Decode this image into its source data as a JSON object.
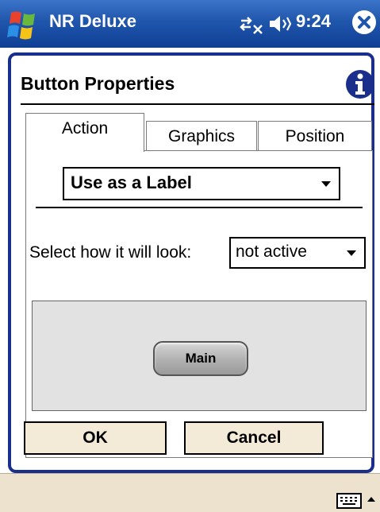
{
  "statusbar": {
    "app_title": "NR Deluxe",
    "clock": "9:24",
    "icons": [
      "windows-start-icon",
      "connectivity-icon",
      "speaker-icon",
      "close-icon"
    ]
  },
  "dialog": {
    "title": "Button Properties",
    "tabs": [
      {
        "label": "Action",
        "active": true
      },
      {
        "label": "Graphics",
        "active": false
      },
      {
        "label": "Position",
        "active": false
      }
    ],
    "action_select": {
      "value": "Use as a Label"
    },
    "look": {
      "label": "Select how it will look:",
      "value": "not active"
    },
    "preview_button_label": "Main",
    "ok_label": "OK",
    "cancel_label": "Cancel"
  },
  "colors": {
    "titlebar": "#1f56ad",
    "dialog_border": "#1a2e8c",
    "button_face": "#f3ead8",
    "bottom_bar": "#ece2cd"
  }
}
